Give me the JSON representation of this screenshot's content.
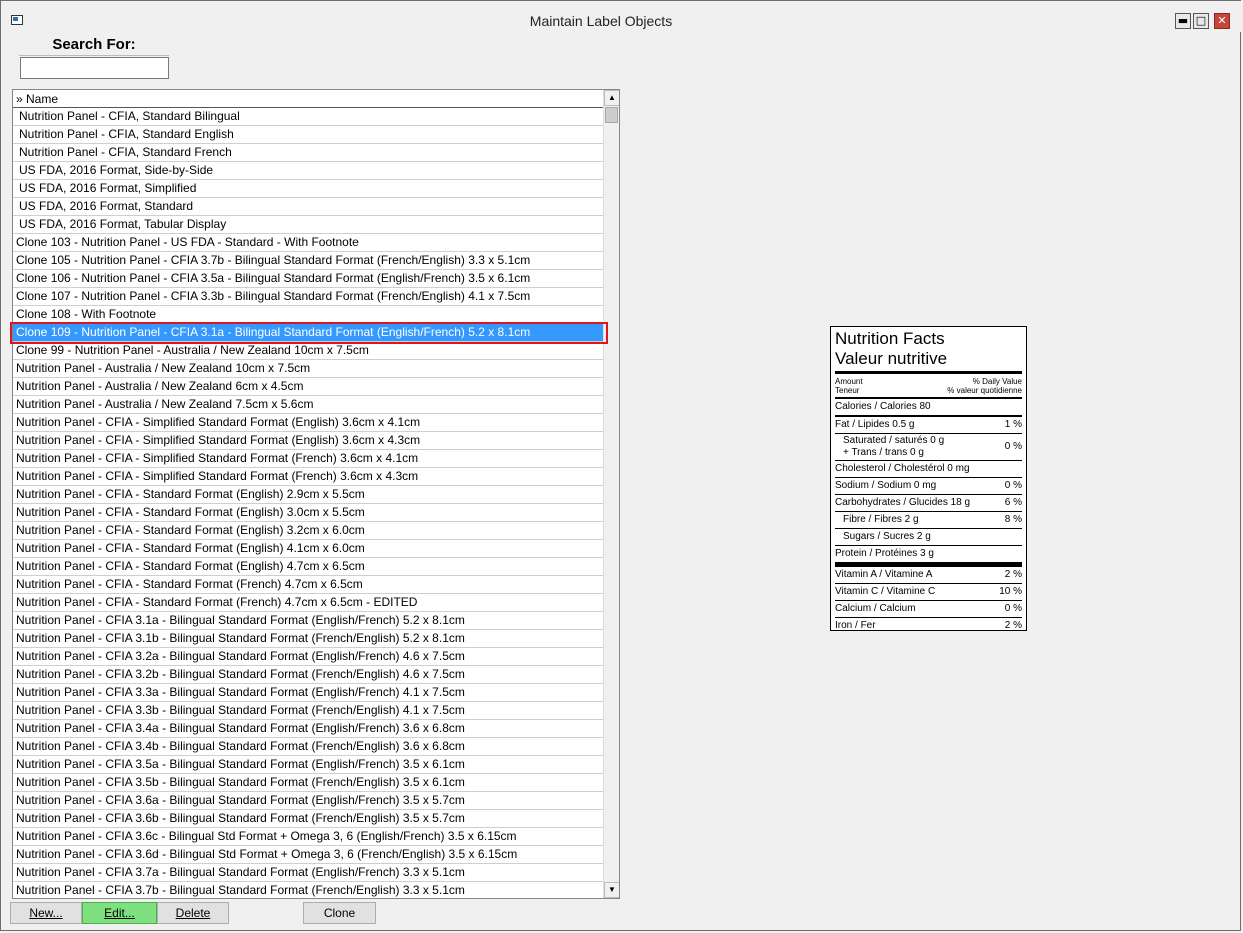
{
  "window": {
    "title": "Maintain Label Objects",
    "controls": {
      "minimize": "▬",
      "maximize": "□",
      "close": "✕"
    }
  },
  "search": {
    "label": "Search For:",
    "value": ""
  },
  "list": {
    "header": "» Name",
    "scroll_up": "▲",
    "scroll_down": "▼",
    "items": [
      {
        "label": "Nutrition Panel - CFIA, Standard Bilingual",
        "indent": true
      },
      {
        "label": "Nutrition Panel - CFIA, Standard English",
        "indent": true
      },
      {
        "label": "Nutrition Panel - CFIA, Standard French",
        "indent": true
      },
      {
        "label": "US FDA, 2016 Format, Side-by-Side",
        "indent": true
      },
      {
        "label": "US FDA, 2016 Format, Simplified",
        "indent": true
      },
      {
        "label": "US FDA, 2016 Format, Standard",
        "indent": true
      },
      {
        "label": "US FDA, 2016 Format, Tabular Display",
        "indent": true
      },
      {
        "label": "Clone 103 - Nutrition Panel - US FDA - Standard - With Footnote"
      },
      {
        "label": "Clone 105 - Nutrition Panel - CFIA 3.7b - Bilingual Standard Format (French/English) 3.3 x 5.1cm"
      },
      {
        "label": "Clone 106 - Nutrition Panel - CFIA 3.5a - Bilingual Standard Format (English/French) 3.5 x 6.1cm"
      },
      {
        "label": "Clone 107 - Nutrition Panel - CFIA 3.3b - Bilingual Standard Format (French/English) 4.1 x 7.5cm"
      },
      {
        "label": "Clone 108 - With Footnote"
      },
      {
        "label": "Clone 109 - Nutrition Panel - CFIA 3.1a - Bilingual Standard Format (English/French) 5.2 x 8.1cm",
        "selected": true
      },
      {
        "label": "Clone 99 - Nutrition Panel - Australia / New Zealand 10cm x 7.5cm"
      },
      {
        "label": "Nutrition Panel - Australia / New Zealand 10cm x 7.5cm"
      },
      {
        "label": "Nutrition Panel - Australia / New Zealand 6cm x 4.5cm"
      },
      {
        "label": "Nutrition Panel - Australia / New Zealand 7.5cm x 5.6cm"
      },
      {
        "label": "Nutrition Panel - CFIA - Simplified Standard Format (English) 3.6cm x 4.1cm"
      },
      {
        "label": "Nutrition Panel - CFIA - Simplified Standard Format (English) 3.6cm x 4.3cm"
      },
      {
        "label": "Nutrition Panel - CFIA - Simplified Standard Format (French) 3.6cm x 4.1cm"
      },
      {
        "label": "Nutrition Panel - CFIA - Simplified Standard Format (French) 3.6cm x 4.3cm"
      },
      {
        "label": "Nutrition Panel - CFIA - Standard Format (English) 2.9cm x 5.5cm"
      },
      {
        "label": "Nutrition Panel - CFIA - Standard Format (English) 3.0cm x 5.5cm"
      },
      {
        "label": "Nutrition Panel - CFIA - Standard Format (English) 3.2cm x 6.0cm"
      },
      {
        "label": "Nutrition Panel - CFIA - Standard Format (English) 4.1cm x 6.0cm"
      },
      {
        "label": "Nutrition Panel - CFIA - Standard Format (English) 4.7cm x 6.5cm"
      },
      {
        "label": "Nutrition Panel - CFIA - Standard Format (French) 4.7cm x 6.5cm"
      },
      {
        "label": "Nutrition Panel - CFIA - Standard Format (French) 4.7cm x 6.5cm - EDITED"
      },
      {
        "label": "Nutrition Panel - CFIA 3.1a - Bilingual Standard Format (English/French) 5.2 x 8.1cm"
      },
      {
        "label": "Nutrition Panel - CFIA 3.1b - Bilingual Standard Format (French/English) 5.2 x 8.1cm"
      },
      {
        "label": "Nutrition Panel - CFIA 3.2a - Bilingual Standard Format (English/French) 4.6 x 7.5cm"
      },
      {
        "label": "Nutrition Panel - CFIA 3.2b - Bilingual Standard Format (French/English) 4.6 x 7.5cm"
      },
      {
        "label": "Nutrition Panel - CFIA 3.3a - Bilingual Standard Format (English/French) 4.1 x 7.5cm"
      },
      {
        "label": "Nutrition Panel - CFIA 3.3b - Bilingual Standard Format (French/English) 4.1 x 7.5cm"
      },
      {
        "label": "Nutrition Panel - CFIA 3.4a - Bilingual Standard Format (English/French) 3.6 x 6.8cm"
      },
      {
        "label": "Nutrition Panel - CFIA 3.4b - Bilingual Standard Format (French/English) 3.6 x 6.8cm"
      },
      {
        "label": "Nutrition Panel - CFIA 3.5a - Bilingual Standard Format (English/French) 3.5 x 6.1cm"
      },
      {
        "label": "Nutrition Panel - CFIA 3.5b - Bilingual Standard Format (French/English) 3.5 x 6.1cm"
      },
      {
        "label": "Nutrition Panel - CFIA 3.6a - Bilingual Standard Format (English/French) 3.5 x 5.7cm"
      },
      {
        "label": "Nutrition Panel - CFIA 3.6b - Bilingual Standard Format (French/English) 3.5 x 5.7cm"
      },
      {
        "label": "Nutrition Panel - CFIA 3.6c - Bilingual Std Format + Omega 3, 6 (English/French) 3.5 x 6.15cm"
      },
      {
        "label": "Nutrition Panel - CFIA 3.6d - Bilingual Std Format + Omega 3, 6 (French/English) 3.5 x 6.15cm"
      },
      {
        "label": "Nutrition Panel - CFIA 3.7a - Bilingual Standard Format (English/French) 3.3 x 5.1cm"
      },
      {
        "label": "Nutrition Panel - CFIA 3.7b - Bilingual Standard Format (French/English) 3.3 x 5.1cm"
      }
    ]
  },
  "buttons": {
    "new": "New...",
    "edit": "Edit...",
    "delete": "Delete",
    "clone": "Clone"
  },
  "preview": {
    "title_en": "Nutrition Facts",
    "title_fr": "Valeur nutritive",
    "amount": "Amount",
    "teneur": "Teneur",
    "daily_value": "% Daily  Value",
    "valeur_quotidienne": "% valeur quotidienne",
    "calories": "Calories / Calories 80",
    "fat": {
      "label": "Fat / Lipides 0.5 g",
      "pct": "1 %"
    },
    "saturated": "Saturated / saturés 0 g",
    "trans": "+ Trans / trans 0 g",
    "sat_trans_pct": "0 %",
    "cholesterol": "Cholesterol / Cholestérol 0 mg",
    "sodium": {
      "label": "Sodium / Sodium 0 mg",
      "pct": "0 %"
    },
    "carbs": {
      "label": "Carbohydrates / Glucides 18 g",
      "pct": "6 %"
    },
    "fibre": {
      "label": "Fibre / Fibres 2 g",
      "pct": "8 %"
    },
    "sugars": "Sugars / Sucres 2 g",
    "protein": "Protein / Protéines 3 g",
    "vitamin_a": {
      "label": "Vitamin A / Vitamine A",
      "pct": "2 %"
    },
    "vitamin_c": {
      "label": "Vitamin C / Vitamine C",
      "pct": "10 %"
    },
    "calcium": {
      "label": "Calcium / Calcium",
      "pct": "0 %"
    },
    "iron": {
      "label": "Iron / Fer",
      "pct": "2 %"
    }
  }
}
